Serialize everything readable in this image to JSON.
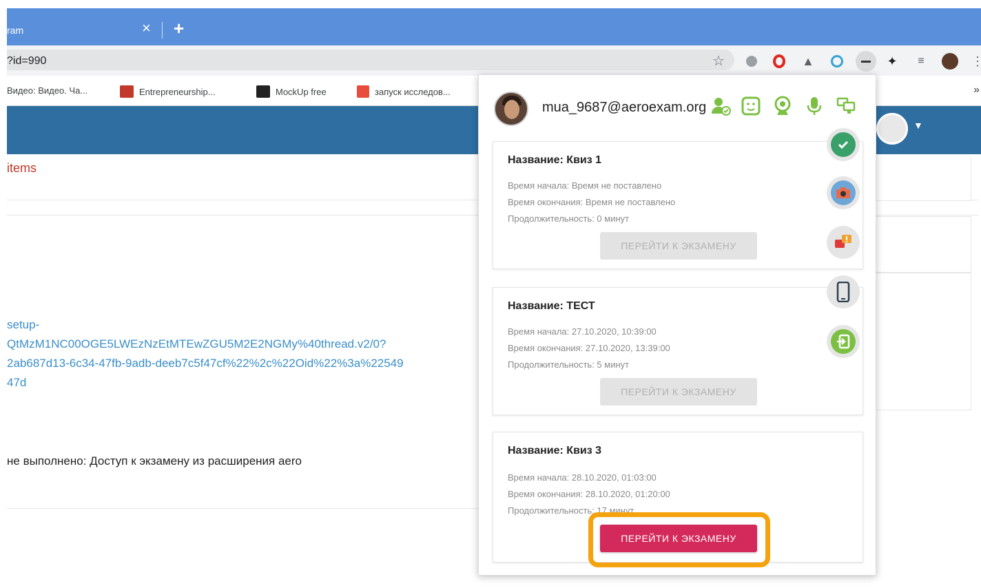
{
  "browser": {
    "tab_title": "ram",
    "tab_close": "×",
    "new_tab": "+",
    "url": "?id=990",
    "bookmarks": [
      {
        "label": "Видео: Видео. Ча...",
        "color": "#ffffff"
      },
      {
        "label": "Entrepreneurship...",
        "color": "#c0392b"
      },
      {
        "label": "MockUp free",
        "color": "#222222"
      },
      {
        "label": "запуск исследов...",
        "color": "#e74c3c"
      }
    ],
    "bookmarks_more": "»",
    "extension_icons": [
      "grey-circle-icon",
      "opera-icon",
      "drive-icon",
      "timer-icon",
      "minus-icon",
      "puzzle-icon",
      "playlist-icon",
      "profile-icon",
      "menu-icon"
    ]
  },
  "page": {
    "nav_link": "items",
    "link_lines": [
      "setup-",
      "QtMzM1NC00OGE5LWEzNzEtMTEwZGU5M2E2NGMy%40thread.v2/0?",
      "2ab687d13-6c34-47fb-9adb-deeb7c5f47cf%22%2c%22Oid%22%3a%22549",
      "47d"
    ],
    "status_text": "не выполнено: Доступ к экзамену из расширения aero"
  },
  "popup": {
    "email": "mua_9687@aeroexam.org",
    "header_icons": [
      "user-status-icon",
      "face-id-icon",
      "webcam-icon",
      "microphone-icon",
      "screen-share-icon"
    ],
    "exams": [
      {
        "title": "Название: Квиз 1",
        "start": "Время начала: Время не поставлено",
        "end": "Время окончания: Время не поставлено",
        "duration": "Продолжительность: 0 минут",
        "button": "ПЕРЕЙТИ К ЭКЗАМЕНУ",
        "enabled": false
      },
      {
        "title": "Название: ТЕСТ",
        "start": "Время начала: 27.10.2020, 10:39:00",
        "end": "Время окончания: 27.10.2020, 13:39:00",
        "duration": "Продолжительность: 5 минут",
        "button": "ПЕРЕЙТИ К ЭКЗАМЕНУ",
        "enabled": false
      },
      {
        "title": "Название: Квиз 3",
        "start": "Время начала: 28.10.2020, 01:03:00",
        "end": "Время окончания: 28.10.2020, 01:20:00",
        "duration": "Продолжительность: 17 минут",
        "button": "ПЕРЕЙТИ К ЭКЗАМЕНУ",
        "enabled": true
      }
    ],
    "side_buttons": [
      "check-icon",
      "camera-icon",
      "chat-alert-icon",
      "phone-icon",
      "exit-icon"
    ]
  },
  "colors": {
    "tab_bar": "#5a8fdc",
    "site_header": "#2e6ea0",
    "accent_button": "#d42a5b",
    "highlight": "#f5a20f",
    "status_green": "#7bc043",
    "link_blue": "#3a8ec9",
    "link_red": "#c0392b"
  }
}
